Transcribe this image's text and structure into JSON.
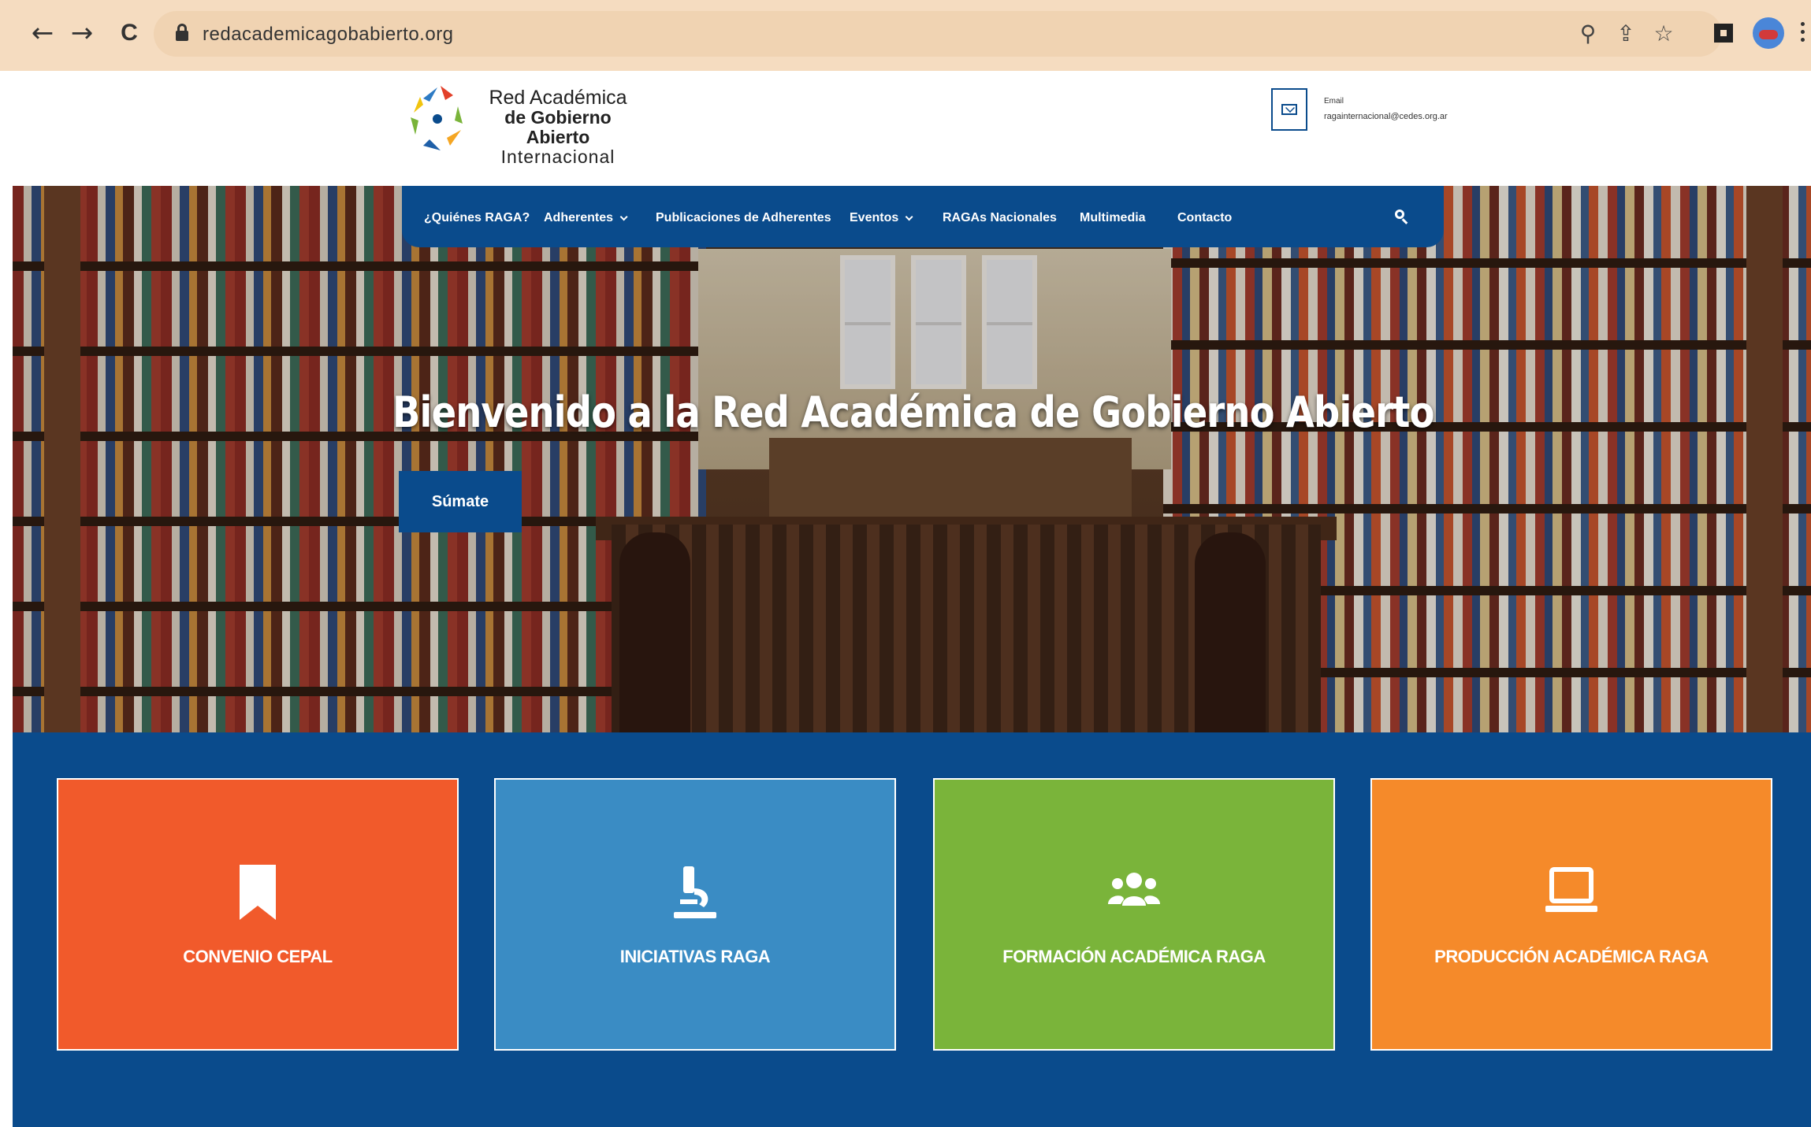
{
  "browser": {
    "url": "redacademicagobabierto.org",
    "back_icon": "←",
    "forward_icon": "→",
    "reload_icon": "C",
    "zoom_icon": "⚲",
    "share_icon": "⇪",
    "star_icon": "☆"
  },
  "header": {
    "logo": {
      "line1": "Red Académica",
      "line2": "de Gobierno Abierto",
      "line3": "Internacional"
    },
    "contact": {
      "label": "Email",
      "value": "ragainternacional@cedes.org.ar"
    }
  },
  "nav": {
    "items": [
      {
        "label": "¿Quiénes RAGA?"
      },
      {
        "label": "Adherentes"
      },
      {
        "label": "Publicaciones de Adherentes"
      },
      {
        "label": "Eventos"
      },
      {
        "label": "RAGAs Nacionales"
      },
      {
        "label": "Multimedia"
      },
      {
        "label": "Contacto"
      }
    ]
  },
  "hero": {
    "title": "Bienvenido a la Red Académica de Gobierno Abierto",
    "cta": "Súmate"
  },
  "cards": [
    {
      "label": "CONVENIO CEPAL",
      "icon": "bookmark-icon",
      "color": "#f15a2b"
    },
    {
      "label": "INICIATIVAS RAGA",
      "icon": "microscope-icon",
      "color": "#3a8cc4"
    },
    {
      "label": "FORMACIÓN ACADÉMICA RAGA",
      "icon": "users-icon",
      "color": "#7ab43a"
    },
    {
      "label": "PRODUCCIÓN ACADÉMICA RAGA",
      "icon": "laptop-icon",
      "color": "#f58a2a"
    }
  ],
  "colors": {
    "brand_blue": "#0a4b8c",
    "chrome_bg": "#f5dcc0"
  }
}
